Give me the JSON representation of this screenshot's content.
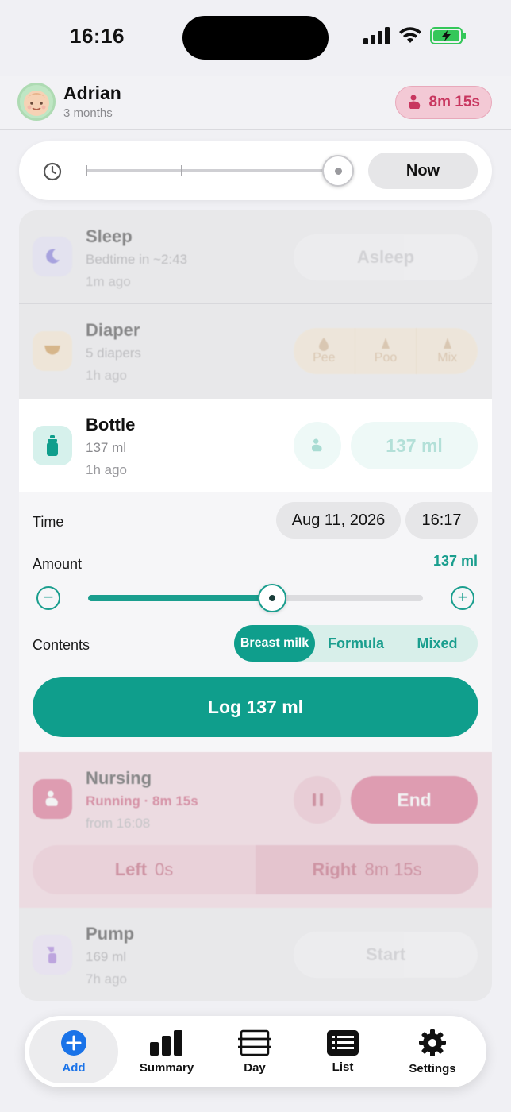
{
  "status_bar": {
    "time": "16:16"
  },
  "header": {
    "baby_name": "Adrian",
    "baby_age": "3 months",
    "timer": "8m 15s"
  },
  "scrubber": {
    "now_label": "Now"
  },
  "events": {
    "sleep": {
      "title": "Sleep",
      "sub": "Bedtime in ~2:43",
      "ago": "1m ago",
      "action": "Asleep"
    },
    "diaper": {
      "title": "Diaper",
      "sub": "5 diapers",
      "ago": "1h ago",
      "options": [
        "Pee",
        "Poo",
        "Mix"
      ]
    },
    "bottle": {
      "title": "Bottle",
      "sub": "137 ml",
      "ago": "1h ago",
      "quick_amount": "137 ml",
      "time_label": "Time",
      "date": "Aug 11, 2026",
      "time": "16:17",
      "amount_label": "Amount",
      "amount_value": "137 ml",
      "amount_fraction": 0.55,
      "contents_label": "Contents",
      "contents_options": [
        "Breast milk",
        "Formula",
        "Mixed"
      ],
      "contents_selected": "Breast milk",
      "log_label": "Log 137 ml"
    },
    "nursing": {
      "title": "Nursing",
      "sub": "Running · 8m 15s",
      "ago": "from 16:08",
      "end_label": "End",
      "left_label": "Left",
      "left_value": "0s",
      "right_label": "Right",
      "right_value": "8m 15s"
    },
    "pump": {
      "title": "Pump",
      "sub": "169 ml",
      "ago": "7h ago",
      "action": "Start"
    }
  },
  "tabbar": {
    "tabs": [
      {
        "label": "Add",
        "icon": "plus-circle-icon",
        "active": true
      },
      {
        "label": "Summary",
        "icon": "bar-chart-icon",
        "active": false
      },
      {
        "label": "Day",
        "icon": "day-timeline-icon",
        "active": false
      },
      {
        "label": "List",
        "icon": "list-icon",
        "active": false
      },
      {
        "label": "Settings",
        "icon": "gear-icon",
        "active": false
      }
    ]
  },
  "colors": {
    "accent_teal": "#0f9e8c",
    "nursing_pink": "#d2416d",
    "active_tab_blue": "#1a73e8"
  }
}
